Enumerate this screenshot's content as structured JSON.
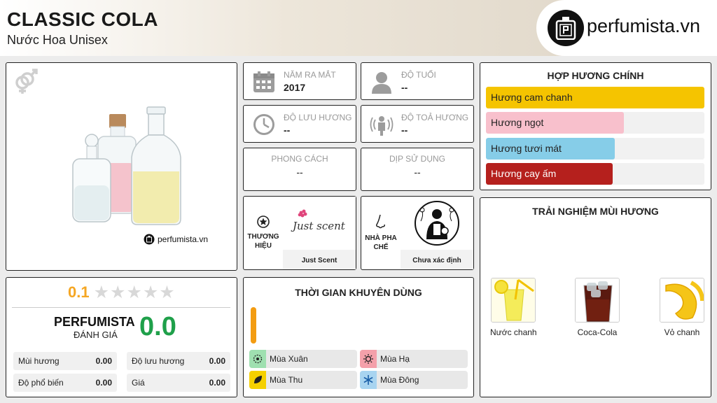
{
  "header": {
    "title": "CLASSIC COLA",
    "subtitle": "Nước Hoa Unisex",
    "logo_text": "perfumista.vn"
  },
  "product": {
    "gender_icon": "male-female-icon",
    "watermark": "perfumista.vn"
  },
  "info": {
    "launch_year": {
      "label": "NĂM RA MẮT",
      "value": "2017"
    },
    "age": {
      "label": "ĐỘ TUỔI",
      "value": "--"
    },
    "longevity": {
      "label": "ĐỘ LƯU HƯƠNG",
      "value": "--"
    },
    "sillage": {
      "label": "ĐỘ TOẢ HƯƠNG",
      "value": "--"
    },
    "style": {
      "label": "PHONG CÁCH",
      "value": "--"
    },
    "occasion": {
      "label": "DỊP SỬ DỤNG",
      "value": "--"
    }
  },
  "brand": {
    "caption": "THƯƠNG HIỆU",
    "logo_text": "Just scent",
    "name": "Just Scent"
  },
  "perfumer": {
    "caption": "NHÀ PHA CHẾ",
    "name": "Chưa xác định"
  },
  "accords": {
    "title": "HỢP HƯƠNG CHÍNH",
    "items": [
      {
        "label": "Hương cam chanh",
        "level": 1.0,
        "color": "#f5c400"
      },
      {
        "label": "Hương ngọt",
        "level": 0.63,
        "color": "#f8c0cc"
      },
      {
        "label": "Hương tươi mát",
        "level": 0.59,
        "color": "#86cde8"
      },
      {
        "label": "Hương cay ấm",
        "level": 0.58,
        "color": "#b5201d"
      }
    ]
  },
  "experience": {
    "title": "TRẢI NGHIỆM MÙI HƯƠNG",
    "items": [
      {
        "label": "Nước chanh"
      },
      {
        "label": "Coca-Cola"
      },
      {
        "label": "Vỏ chanh"
      }
    ]
  },
  "rating": {
    "score": "0.1",
    "stars_filled": 0,
    "stars_total": 5,
    "perfumista_label": "PERFUMISTA",
    "review_label": "ĐÁNH GIÁ",
    "perfumista_score": "0.0",
    "metrics": [
      {
        "label": "Mùi hương",
        "value": "0.00"
      },
      {
        "label": "Độ lưu hương",
        "value": "0.00"
      },
      {
        "label": "Độ phổ biến",
        "value": "0.00"
      },
      {
        "label": "Giá",
        "value": "0.00"
      }
    ]
  },
  "time": {
    "title": "THỜI GIAN KHUYÊN DÙNG",
    "seasons": [
      {
        "label": "Mùa Xuân",
        "color": "#9fe0b0"
      },
      {
        "label": "Mùa Hạ",
        "color": "#f4a0aa"
      },
      {
        "label": "Mùa Thu",
        "color": "#f5d000"
      },
      {
        "label": "Mùa Đông",
        "color": "#a8d4f0"
      }
    ]
  },
  "colors": {
    "accent_orange": "#f39c12",
    "accent_green": "#1fa04a",
    "star_gold": "#f5a623"
  }
}
